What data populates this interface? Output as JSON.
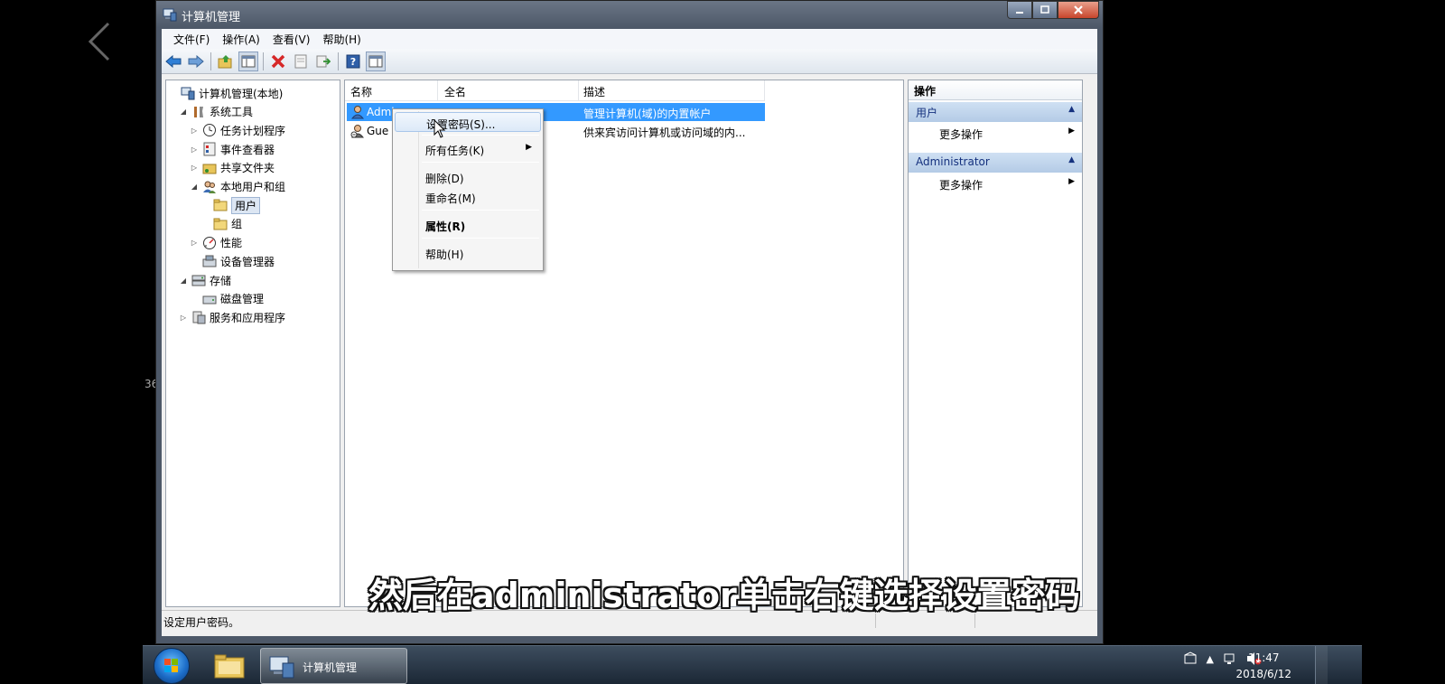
{
  "window": {
    "title": "计算机管理"
  },
  "menubar": {
    "items": [
      "文件(F)",
      "操作(A)",
      "查看(V)",
      "帮助(H)"
    ]
  },
  "tree": {
    "items": [
      {
        "label": "计算机管理(本地)",
        "level": 0,
        "expander": "",
        "icon": "computer-management-icon"
      },
      {
        "label": "系统工具",
        "level": 1,
        "expander": "◢",
        "icon": "tools-icon"
      },
      {
        "label": "任务计划程序",
        "level": 2,
        "expander": "▷",
        "icon": "clock-icon"
      },
      {
        "label": "事件查看器",
        "level": 2,
        "expander": "▷",
        "icon": "event-viewer-icon"
      },
      {
        "label": "共享文件夹",
        "level": 2,
        "expander": "▷",
        "icon": "shared-folder-icon"
      },
      {
        "label": "本地用户和组",
        "level": 2,
        "expander": "◢",
        "icon": "users-icon"
      },
      {
        "label": "用户",
        "level": 3,
        "expander": "",
        "icon": "folder-icon",
        "selected": true
      },
      {
        "label": "组",
        "level": 3,
        "expander": "",
        "icon": "folder-icon"
      },
      {
        "label": "性能",
        "level": 2,
        "expander": "▷",
        "icon": "performance-icon"
      },
      {
        "label": "设备管理器",
        "level": 2,
        "expander": "",
        "icon": "device-manager-icon"
      },
      {
        "label": "存储",
        "level": 1,
        "expander": "◢",
        "icon": "storage-icon"
      },
      {
        "label": "磁盘管理",
        "level": 2,
        "expander": "",
        "icon": "disk-icon"
      },
      {
        "label": "服务和应用程序",
        "level": 1,
        "expander": "▷",
        "icon": "services-icon"
      }
    ]
  },
  "list": {
    "columns": [
      "名称",
      "全名",
      "描述"
    ],
    "rows": [
      {
        "name": "Admi",
        "fullname": "",
        "description": "管理计算机(域)的内置帐户",
        "selected": true
      },
      {
        "name": "Gue",
        "fullname": "",
        "description": "供来宾访问计算机或访问域的内..."
      }
    ]
  },
  "actions": {
    "title": "操作",
    "sections": [
      {
        "label": "用户",
        "item": "更多操作"
      },
      {
        "label": "Administrator",
        "item": "更多操作"
      }
    ]
  },
  "context_menu": {
    "items": [
      {
        "label": "设置密码(S)...",
        "hover": true
      },
      {
        "label": "所有任务(K)",
        "submenu": true
      },
      {
        "label": "删除(D)"
      },
      {
        "label": "重命名(M)"
      },
      {
        "label": "属性(R)",
        "bold": true
      },
      {
        "label": "帮助(H)"
      }
    ]
  },
  "statusbar": {
    "text": "设定用户密码。"
  },
  "subtitle": "然后在administrator单击右键选择设置密码",
  "edge_number": "36",
  "taskbar": {
    "task_label": "计算机管理",
    "time": "11:47",
    "date": "2018/6/12"
  },
  "colors": {
    "selection": "#3399ff",
    "section_header": "#b4cbe6",
    "taskbar": "#1b2735"
  }
}
